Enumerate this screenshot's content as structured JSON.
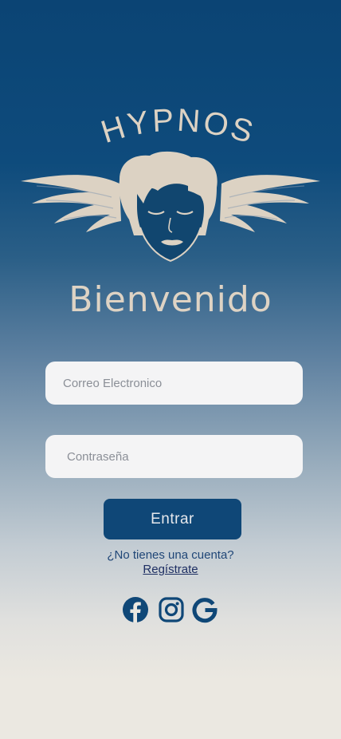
{
  "brand": {
    "name": "HYPNOS",
    "logo_icon": "winged-head-logo"
  },
  "welcome": {
    "title": "Bienvenido"
  },
  "form": {
    "email_placeholder": "Correo Electronico",
    "password_placeholder": "Contraseña",
    "submit_label": "Entrar"
  },
  "signup": {
    "question": "¿No tienes una cuenta?",
    "link_label": "Regístrate"
  },
  "social": [
    {
      "name": "facebook",
      "icon": "facebook-icon"
    },
    {
      "name": "instagram",
      "icon": "instagram-icon"
    },
    {
      "name": "google",
      "icon": "google-icon"
    }
  ],
  "colors": {
    "brand_dark_blue": "#0b4474",
    "cream": "#ded3c4",
    "field_bg": "#f4f4f5",
    "button_bg": "#0f4777",
    "background_bottom": "#ebe8e1"
  }
}
